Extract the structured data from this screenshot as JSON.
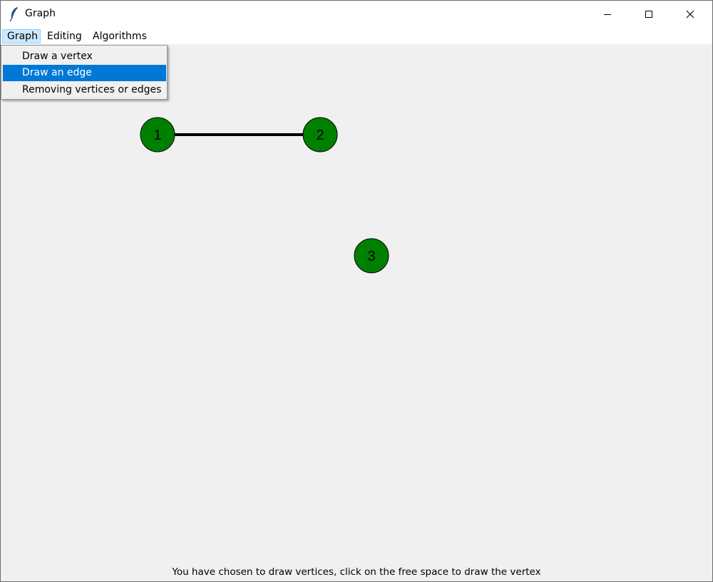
{
  "window": {
    "title": "Graph",
    "icon": "feather-icon",
    "controls": [
      "minimize-icon",
      "maximize-icon",
      "close-icon"
    ]
  },
  "menubar": {
    "items": [
      {
        "label": "Graph",
        "active": true
      },
      {
        "label": "Editing",
        "active": false
      },
      {
        "label": "Algorithms",
        "active": false
      }
    ]
  },
  "dropdown": {
    "items": [
      {
        "label": "Draw a vertex",
        "selected": false
      },
      {
        "label": "Draw an edge",
        "selected": true
      },
      {
        "label": "Removing vertices or edges",
        "selected": false
      }
    ]
  },
  "graph": {
    "vertex_color": "#008000",
    "edge_color": "#000000",
    "vertices": [
      {
        "label": "1"
      },
      {
        "label": "2"
      },
      {
        "label": "3"
      }
    ],
    "edges": [
      {
        "from": "1",
        "to": "2"
      }
    ]
  },
  "status": {
    "text": "You have chosen to draw vertices, click on the free space to draw the vertex"
  },
  "colors": {
    "menu_highlight": "#cce8ff",
    "selection": "#0078d7",
    "canvas_background": "#f0f0f0"
  }
}
